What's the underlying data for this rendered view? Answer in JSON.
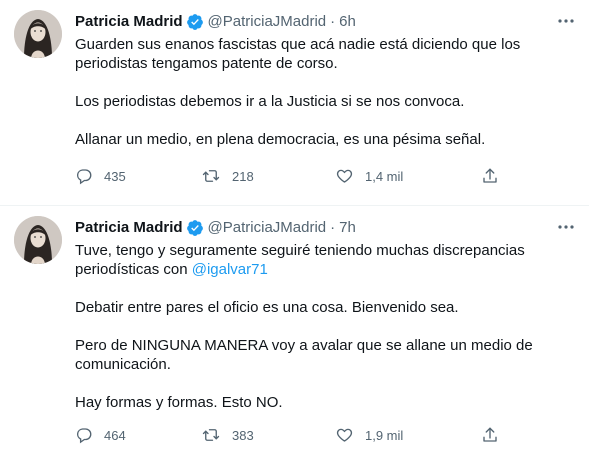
{
  "colors": {
    "text_primary": "#0f1419",
    "text_secondary": "#536471",
    "link": "#1d9bf0",
    "verified": "#1d9bf0",
    "divider": "#eff3f4"
  },
  "tweets": [
    {
      "author": {
        "name": "Patricia Madrid",
        "handle": "@PatriciaJMadrid",
        "verified_icon": "verified-badge-icon"
      },
      "separator": "·",
      "time": "6h",
      "paragraphs": [
        "Guarden sus enanos fascistas que acá nadie está diciendo que los periodistas tengamos patente de corso.",
        "Los periodistas debemos ir a la Justicia si se nos convoca.",
        "Allanar un medio, en plena democracia, es una pésima señal."
      ],
      "actions": {
        "replies": "435",
        "retweets": "218",
        "likes": "1,4 mil"
      }
    },
    {
      "author": {
        "name": "Patricia Madrid",
        "handle": "@PatriciaJMadrid",
        "verified_icon": "verified-badge-icon"
      },
      "separator": "·",
      "time": "7h",
      "paragraph1_text": "Tuve, tengo y seguramente seguiré teniendo muchas discrepancias periodísticas con ",
      "paragraph1_mention": "@igalvar71",
      "paragraphs": [
        "Debatir entre pares el oficio es una cosa. Bienvenido sea.",
        "Pero de NINGUNA MANERA voy a avalar que se allane un medio de comunicación.",
        "Hay formas y formas. Esto NO."
      ],
      "actions": {
        "replies": "464",
        "retweets": "383",
        "likes": "1,9 mil"
      }
    }
  ]
}
